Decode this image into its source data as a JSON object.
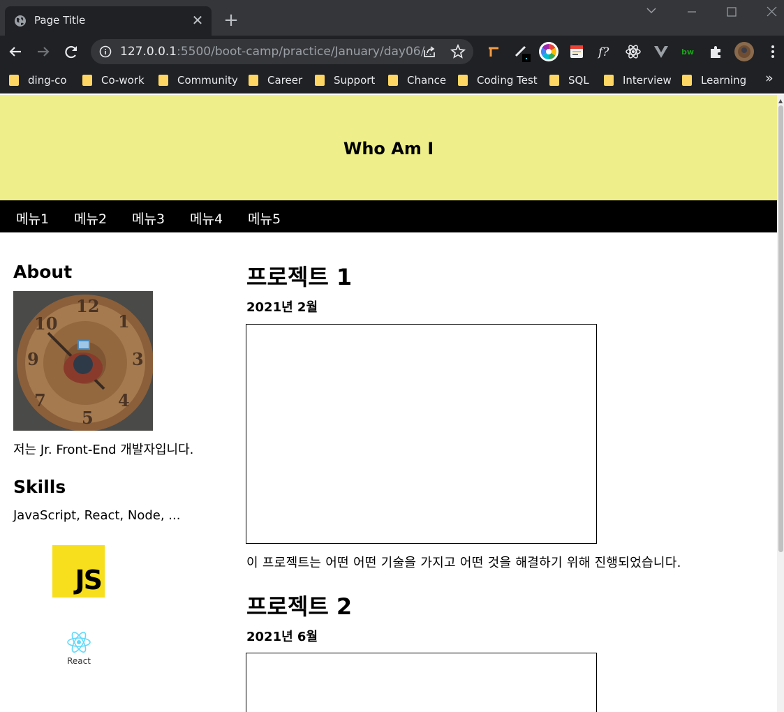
{
  "browser": {
    "tab_title": "Page Title",
    "url_host": "127.0.0.1",
    "url_rest": ":5500/boot-camp/practice/January/day06/...",
    "bookmarks": [
      "ding-co",
      "Co-work",
      "Community",
      "Career",
      "Support",
      "Chance",
      "Coding Test",
      "SQL",
      "Interview",
      "Learning"
    ],
    "more_bookmarks": "»"
  },
  "site": {
    "title": "Who Am I",
    "nav": [
      "메뉴1",
      "메뉴2",
      "메뉴3",
      "메뉴4",
      "메뉴5"
    ]
  },
  "sidebar": {
    "about_heading": "About",
    "about_text": "저는 Jr. Front-End 개발자입니다.",
    "skills_heading": "Skills",
    "skills_text": "JavaScript, React, Node, ...",
    "js_logo_text": "JS",
    "react_logo_text": "React"
  },
  "projects": [
    {
      "title": "프로젝트 1",
      "date": "2021년 2월",
      "description": "이 프로젝트는 어떤 어떤 기술을 가지고 어떤 것을 해결하기 위해 진행되었습니다."
    },
    {
      "title": "프로젝트 2",
      "date": "2021년 6월"
    }
  ],
  "colors": {
    "header_bg": "#eeee8a",
    "nav_bg": "#000000",
    "chrome_dark": "#202124",
    "tabstrip": "#35363a"
  }
}
